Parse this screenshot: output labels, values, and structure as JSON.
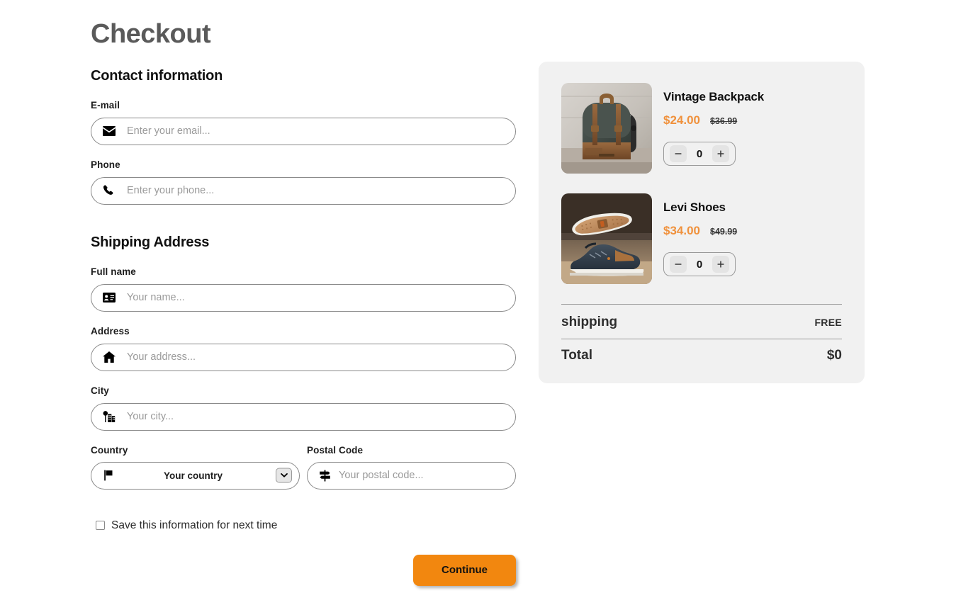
{
  "page": {
    "title": "Checkout"
  },
  "contact": {
    "section_title": "Contact information",
    "fields": [
      {
        "label": "E-mail",
        "placeholder": "Enter your email...",
        "value": "",
        "icon": "envelope-icon"
      },
      {
        "label": "Phone",
        "placeholder": "Enter your phone...",
        "value": "",
        "icon": "phone-icon"
      }
    ]
  },
  "shipping": {
    "section_title": "Shipping Address",
    "fields": [
      {
        "label": "Full name",
        "placeholder": "Your name...",
        "value": "",
        "icon": "id-card-icon"
      },
      {
        "label": "Address",
        "placeholder": "Your address...",
        "value": "",
        "icon": "home-icon"
      },
      {
        "label": "City",
        "placeholder": "Your city...",
        "value": "",
        "icon": "city-icon"
      }
    ],
    "country": {
      "label": "Country",
      "selected": "Your country",
      "icon": "flag-icon",
      "dropdown_icon": "chevron-down-icon"
    },
    "postal": {
      "label": "Postal Code",
      "placeholder": "Your postal code...",
      "value": "",
      "icon": "signpost-icon"
    }
  },
  "save_option": {
    "label": "Save this information for next time",
    "checked": false
  },
  "actions": {
    "continue_label": "Continue"
  },
  "summary": {
    "products": [
      {
        "name": "Vintage Backpack",
        "price": "$24.00",
        "old_price": "$36.99",
        "quantity": "0",
        "decrease_label": "−",
        "increase_label": "+",
        "image_alt": "vintage-backpack-photo"
      },
      {
        "name": "Levi Shoes",
        "price": "$34.00",
        "old_price": "$49.99",
        "quantity": "0",
        "decrease_label": "−",
        "increase_label": "+",
        "image_alt": "levi-shoes-photo"
      }
    ],
    "shipping_row": {
      "label": "shipping",
      "value": "FREE"
    },
    "total_row": {
      "label": "Total",
      "value": "$0"
    }
  },
  "colors": {
    "accent_orange": "#f2870f",
    "price_orange": "#f0913c",
    "panel_bg": "#f1f1f1",
    "title_gray": "#5a5a5a"
  }
}
